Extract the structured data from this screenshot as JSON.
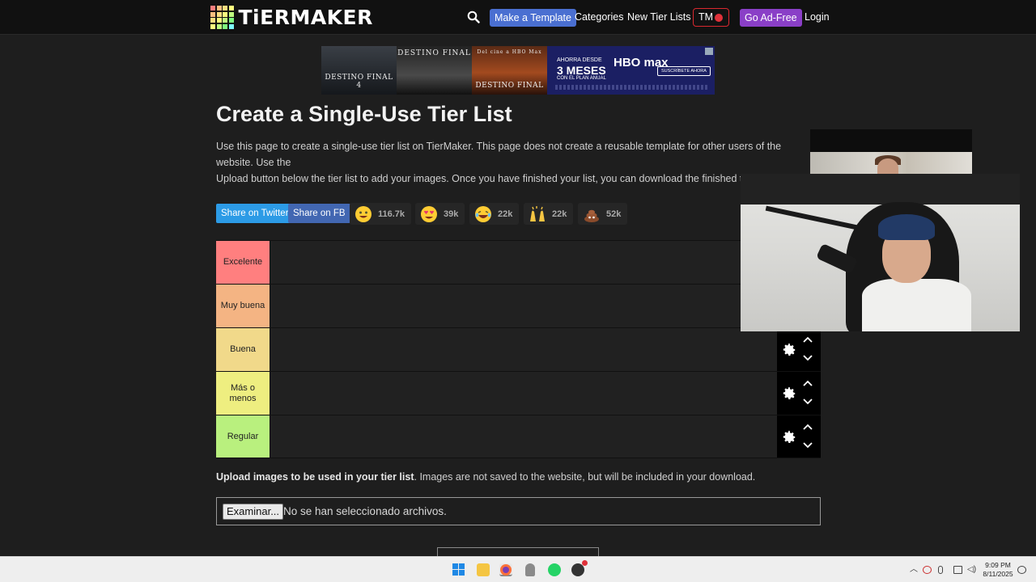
{
  "header": {
    "logo_text": "TiERMAKER",
    "nav": {
      "make_template": "Make a Template",
      "categories": "Categories",
      "new_tier_lists": "New Tier Lists",
      "tm": "TM",
      "go_ad_free": "Go Ad-Free",
      "login": "Login"
    }
  },
  "ad": {
    "tile1_caption": "DESTINO FINAL 4",
    "tile2_caption": "DESTINO FINAL",
    "tile3_top": "Del cine a HBO Max",
    "tile3_caption": "DESTINO FINAL",
    "hbo_line1": "AHORRA DESDE",
    "hbo_line2": "3 MESES",
    "hbo_line3": "CON EL PLAN ANUAL",
    "hbo_logo": "HBO max",
    "hbo_cta": "SUSCRÍBETE AHORA"
  },
  "main": {
    "title": "Create a Single-Use Tier List",
    "intro": "Use this page to create a single-use tier list on TierMaker. This page does not create a reusable template for other users of the website. Use the\nUpload button below the tier list to add your images. Once you have finished your list, you can download the finished tier list image. It is not possibl\nto save a single-use tier list to your profile page. Refreshing the page will cause your images to be removed.",
    "share_twitter": "Share on Twitter",
    "share_fb": "Share on FB",
    "reactions": [
      {
        "icon": "grin-emoji-icon",
        "count": "116.7k"
      },
      {
        "icon": "heart-eyes-emoji-icon",
        "count": "39k"
      },
      {
        "icon": "laughing-emoji-icon",
        "count": "22k"
      },
      {
        "icon": "raised-hands-emoji-icon",
        "count": "22k"
      },
      {
        "icon": "poop-emoji-icon",
        "count": "52k"
      }
    ],
    "tiers": [
      {
        "label": "Excelente",
        "color": "#ff7f7f"
      },
      {
        "label": "Muy buena",
        "color": "#ffbf7f"
      },
      {
        "label": "Buena",
        "color": "#ffdf7f"
      },
      {
        "label": "Más o menos",
        "color": "#ffff7f"
      },
      {
        "label": "Regular",
        "color": "#bfff7f"
      }
    ],
    "upload_bold": "Upload images to be used in your tier list",
    "upload_rest": ". Images are not saved to the website, but will be included in your download.",
    "file_button": "Examinar...",
    "file_status": "No se han seleccionado archivos."
  },
  "taskbar": {
    "time": "9:09 PM",
    "date": "8/11/2025"
  },
  "colors": {
    "accent_template": "#4a6fd1",
    "accent_adfree": "#8a3fc7",
    "tm_red": "#e0313a",
    "twitter": "#2c9be6",
    "facebook": "#4267b2"
  }
}
